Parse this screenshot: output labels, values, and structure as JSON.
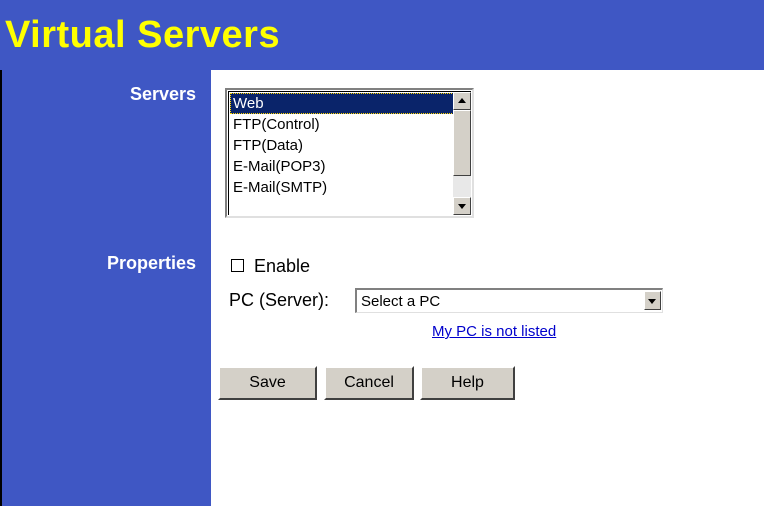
{
  "page": {
    "title": "Virtual Servers"
  },
  "servers": {
    "label": "Servers",
    "items": [
      {
        "label": "Web",
        "selected": true
      },
      {
        "label": "FTP(Control)",
        "selected": false
      },
      {
        "label": "FTP(Data)",
        "selected": false
      },
      {
        "label": "E-Mail(POP3)",
        "selected": false
      },
      {
        "label": "E-Mail(SMTP)",
        "selected": false
      }
    ]
  },
  "properties": {
    "label": "Properties",
    "enable_label": "Enable",
    "enable_checked": false,
    "pc_label": "PC (Server):",
    "pc_select_value": "Select a PC",
    "not_listed_link": "My PC is not listed"
  },
  "buttons": {
    "save": "Save",
    "cancel": "Cancel",
    "help": "Help"
  },
  "colors": {
    "header_bg": "#3f57c4",
    "title_text": "#ffff00",
    "label_text": "#ffffff",
    "selection_bg": "#0a246a",
    "link": "#0000cc"
  }
}
